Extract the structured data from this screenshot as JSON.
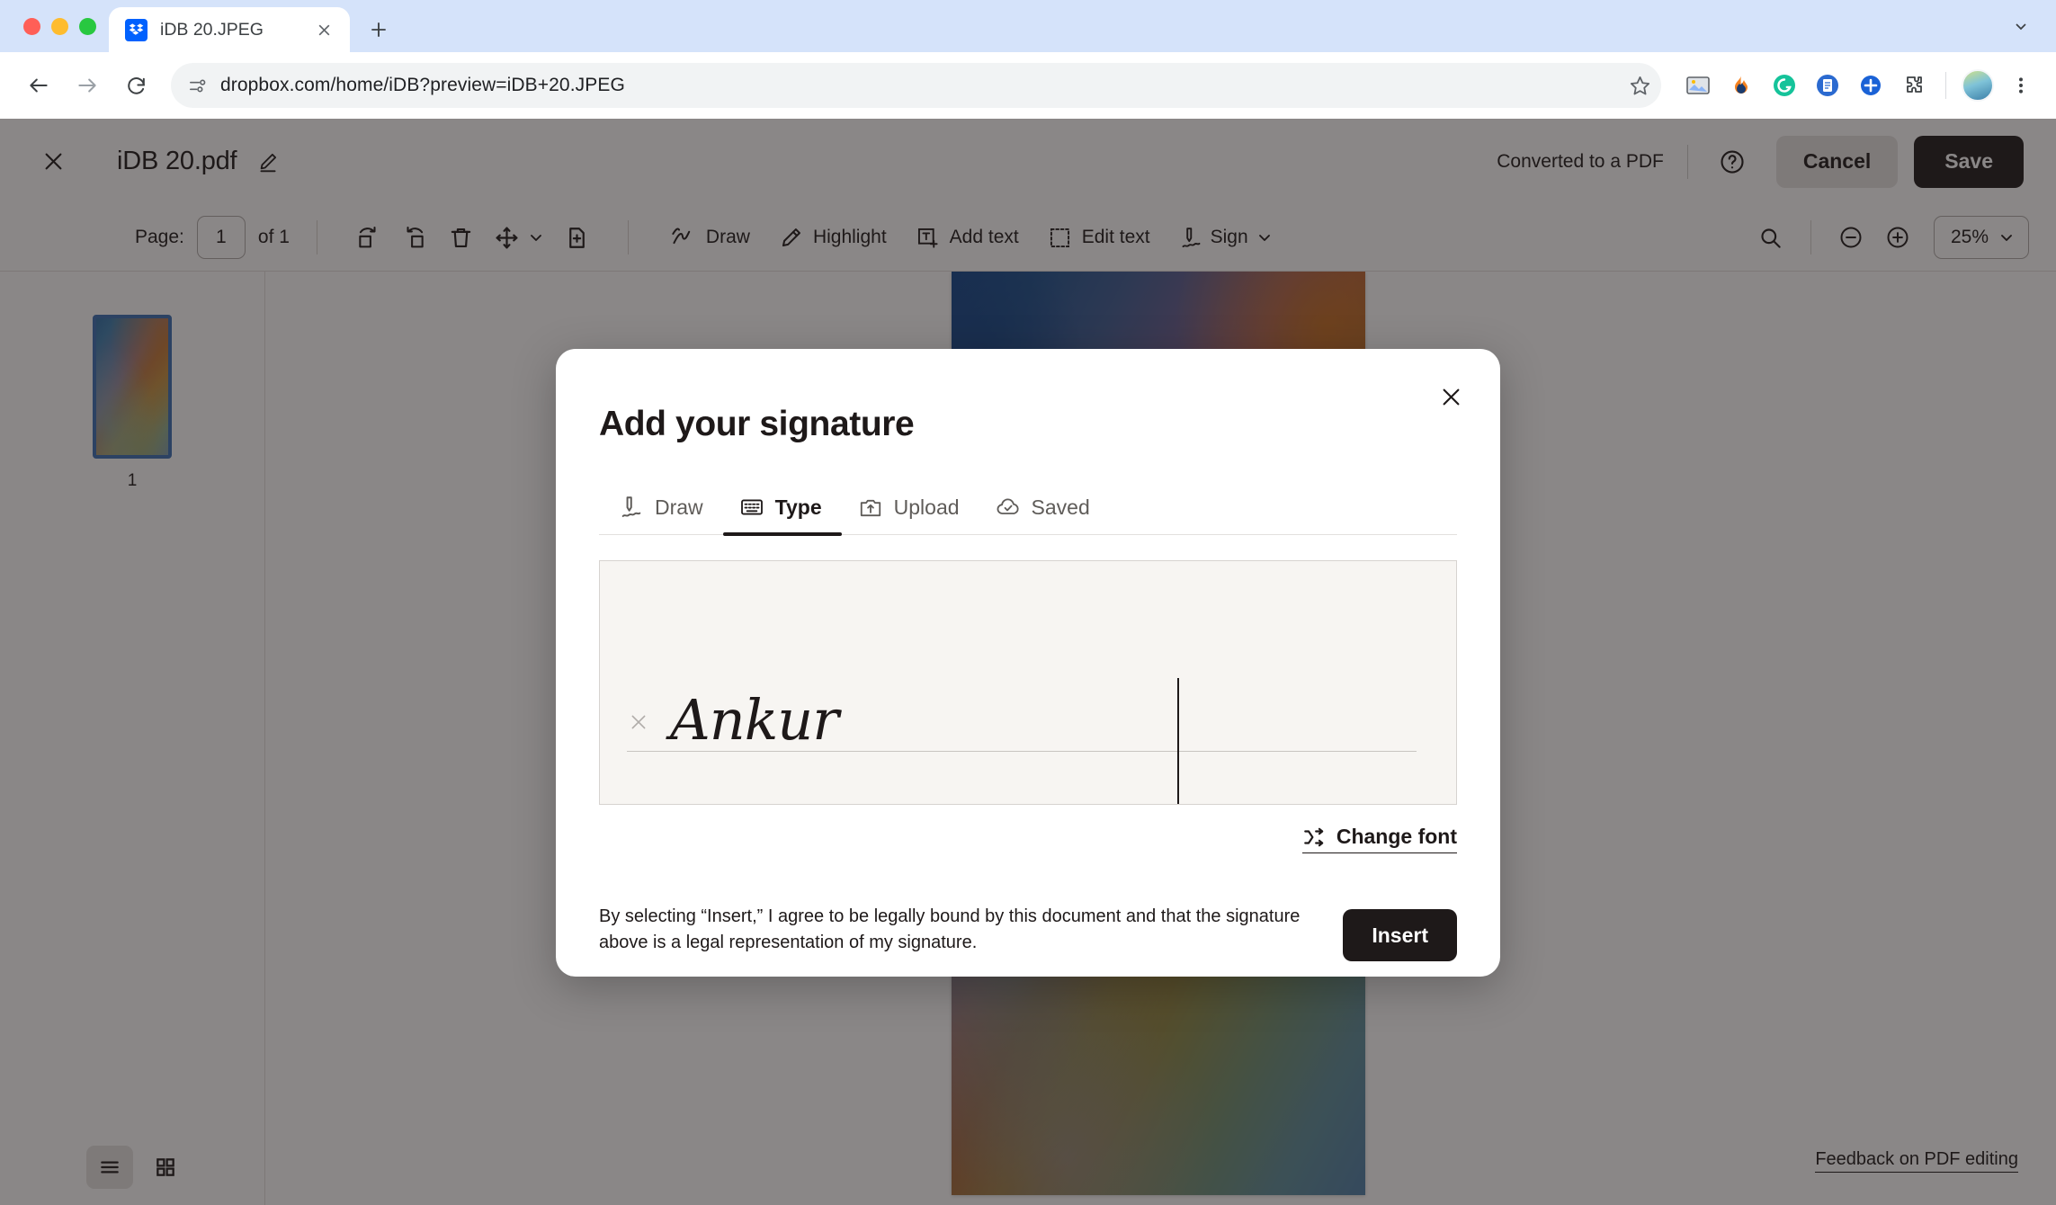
{
  "browser": {
    "tab": {
      "title": "iDB 20.JPEG",
      "favicon": "dropbox-icon",
      "close": "close-icon"
    },
    "new_tab_label": "+",
    "url": "dropbox.com/home/iDB?preview=iDB+20.JPEG",
    "nav": {
      "back": "back-arrow-icon",
      "forward": "forward-arrow-icon",
      "reload": "reload-icon"
    },
    "site_info": "site-settings-icon",
    "bookmark": "star-icon",
    "extensions": [
      "screenshot-extension-icon",
      "flame-extension-icon",
      "grammarly-extension-icon",
      "docs-extension-icon",
      "plus-circle-extension-icon",
      "puzzle-extensions-icon"
    ],
    "profile": "profile-avatar",
    "menu": "kebab-menu-icon"
  },
  "app": {
    "close_label": "close-icon",
    "doc_title": "iDB 20.pdf",
    "rename_icon": "pencil-icon",
    "converted_status": "Converted to a PDF",
    "help_icon": "question-mark-icon",
    "cancel_label": "Cancel",
    "save_label": "Save",
    "feedback_label": "Feedback on PDF editing"
  },
  "toolbar": {
    "page_label": "Page:",
    "page_value": "1",
    "of_label": "of 1",
    "icons": [
      {
        "name": "rotate-clockwise-icon"
      },
      {
        "name": "rotate-counterclockwise-icon"
      },
      {
        "name": "delete-page-icon"
      },
      {
        "name": "move-page-icon"
      },
      {
        "name": "add-page-icon"
      }
    ],
    "tools": [
      {
        "label": "Draw",
        "icon": "draw-icon"
      },
      {
        "label": "Highlight",
        "icon": "highlighter-icon"
      },
      {
        "label": "Add text",
        "icon": "add-text-icon"
      },
      {
        "label": "Edit text",
        "icon": "edit-text-icon"
      },
      {
        "label": "Sign",
        "icon": "sign-pen-icon"
      }
    ],
    "search_icon": "search-icon",
    "zoom_out_icon": "zoom-out-icon",
    "zoom_in_icon": "zoom-in-icon",
    "zoom_value": "25%"
  },
  "thumbnails": {
    "pages": [
      {
        "number": "1"
      }
    ],
    "list_view_icon": "list-view-icon",
    "grid_view_icon": "grid-view-icon"
  },
  "modal": {
    "title": "Add your signature",
    "close_icon": "close-icon",
    "tabs": [
      {
        "label": "Draw",
        "icon": "draw-pen-icon",
        "active": false
      },
      {
        "label": "Type",
        "icon": "keyboard-icon",
        "active": true
      },
      {
        "label": "Upload",
        "icon": "camera-upload-icon",
        "active": false
      },
      {
        "label": "Saved",
        "icon": "saved-cloud-icon",
        "active": false
      }
    ],
    "signature_value": "Ankur",
    "signature_placeholder": "",
    "clear_icon": "clear-x-icon",
    "change_font_label": "Change font",
    "change_font_icon": "shuffle-icon",
    "legal_text": "By selecting “Insert,” I agree to be legally bound by this document and that the signature above is a legal representation of my signature.",
    "insert_label": "Insert"
  }
}
